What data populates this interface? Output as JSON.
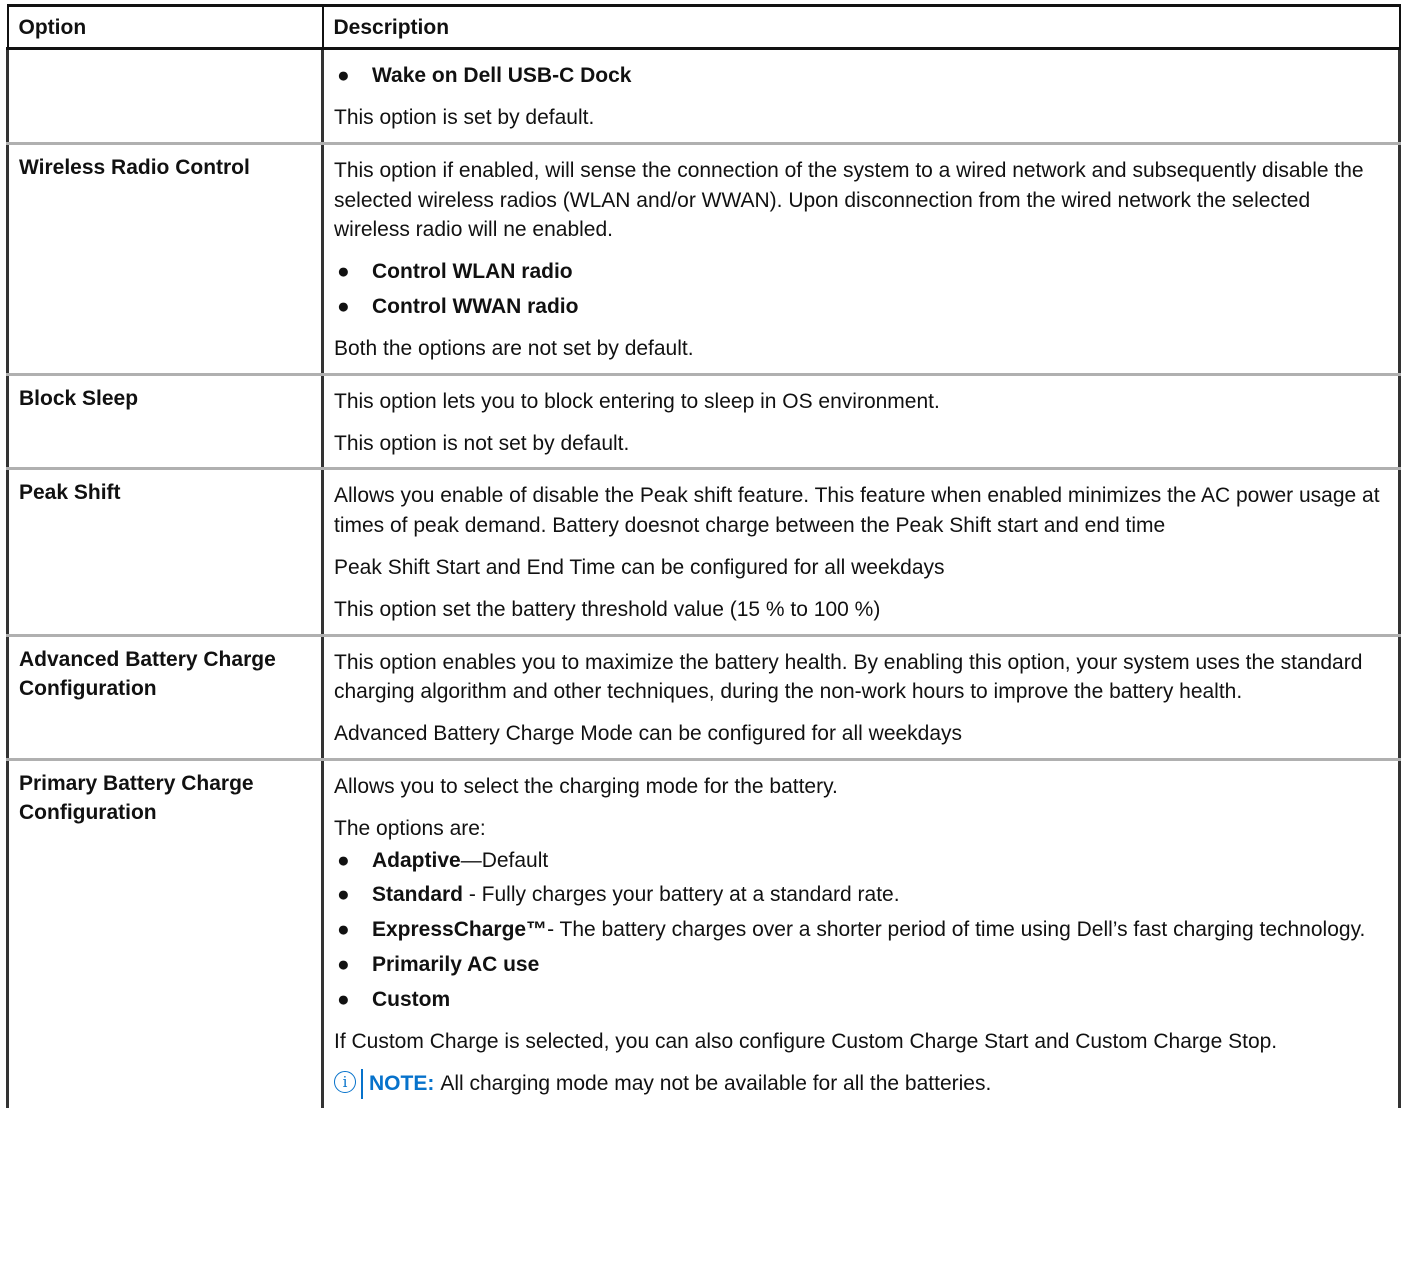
{
  "table": {
    "headers": [
      "Option",
      "Description"
    ],
    "rows": [
      {
        "option": "",
        "bullets_top": [
          "Wake on Dell USB-C Dock"
        ],
        "text": "This option is set by default."
      },
      {
        "option": "Wireless Radio Control",
        "text1": "This option if enabled, will sense the connection of the system to a wired network and subsequently disable the selected wireless radios (WLAN and/or WWAN). Upon disconnection from the wired network the selected wireless radio will ne enabled.",
        "bullets": [
          "Control WLAN radio",
          "Control WWAN radio"
        ],
        "text2": "Both the options are not set by default."
      },
      {
        "option": "Block Sleep",
        "text1": "This option lets you to block entering to sleep in OS environment.",
        "text2": "This option is not set by default."
      },
      {
        "option": "Peak Shift",
        "text1": "Allows you enable of disable the Peak shift feature. This feature when enabled minimizes the AC power usage at times of peak demand. Battery doesnot charge between the Peak Shift start and end time",
        "text2": "Peak Shift Start and End Time can be configured for all weekdays",
        "text3": "This option set the battery threshold value (15 % to 100 %)"
      },
      {
        "option": "Advanced Battery Charge Configuration",
        "text1": "This option enables you to maximize the battery health. By enabling this option, your system uses the standard charging algorithm and other techniques, during the non-work hours to improve the battery health.",
        "text2": "Advanced Battery Charge Mode can be configured for all weekdays"
      },
      {
        "option": "Primary Battery Charge Configuration",
        "text1": "Allows you to select the charging mode for the battery.",
        "intro": "The options are:",
        "bullets": [
          {
            "bold": "Adaptive",
            "rest": "—Default"
          },
          {
            "bold": "Standard",
            "rest": " - Fully charges your battery at a standard rate."
          },
          {
            "bold": "ExpressCharge™",
            "rest": "- The battery charges over a shorter period of time using Dell’s fast charging technology."
          },
          {
            "bold": "Primarily AC use",
            "rest": ""
          },
          {
            "bold": "Custom",
            "rest": ""
          }
        ],
        "text2": "If Custom Charge is selected, you can also configure Custom Charge Start and Custom Charge Stop.",
        "note_label": "NOTE:",
        "note_text": "All charging mode may not be available for all the batteries."
      }
    ]
  },
  "bullet_glyph": "●",
  "note_icon_glyph": "i",
  "colors": {
    "note_accent": "#0672cb"
  }
}
